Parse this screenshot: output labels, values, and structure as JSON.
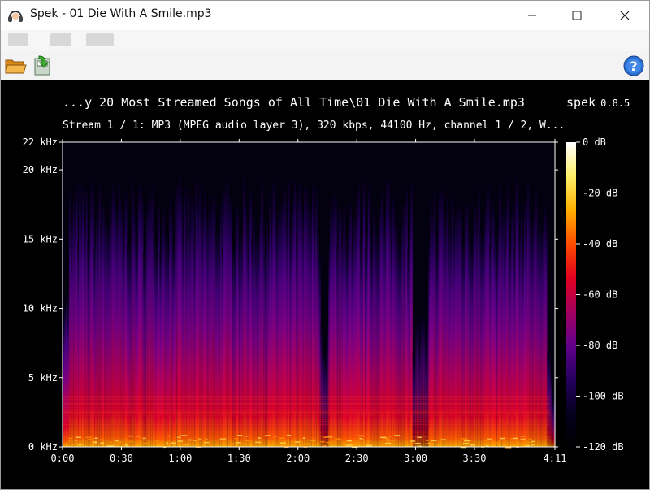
{
  "window": {
    "title": "Spek - 01 Die With A Smile.mp3",
    "app_icon": "headphones-icon",
    "controls": [
      "minimize-icon",
      "maximize-icon",
      "close-icon"
    ]
  },
  "menubar": {
    "note": ""
  },
  "toolbar": {
    "open_icon": "folder-open-icon",
    "save_icon": "save-export-icon",
    "help_icon": "help-icon"
  },
  "spectrogram": {
    "file_title": "...y 20 Most Streamed Songs of All Time\\01 Die With A Smile.mp3",
    "brand": "spek",
    "version": "0.8.5",
    "stream_info": "Stream 1 / 1: MP3 (MPEG audio layer 3), 320 kbps, 44100 Hz, channel 1 / 2, W..."
  },
  "chart_data": {
    "type": "heatmap",
    "xlabel": "",
    "ylabel": "",
    "x_ticks": [
      "0:00",
      "0:30",
      "1:00",
      "1:30",
      "2:00",
      "2:30",
      "3:00",
      "3:30",
      "4:11"
    ],
    "x_tick_seconds": [
      0,
      30,
      60,
      90,
      120,
      150,
      180,
      210,
      251
    ],
    "y_ticks": [
      "0 kHz",
      "5 kHz",
      "10 kHz",
      "15 kHz",
      "20 kHz",
      "22 kHz"
    ],
    "y_tick_khz": [
      0,
      5,
      10,
      15,
      20,
      22
    ],
    "xlim": [
      0,
      251
    ],
    "ylim": [
      0,
      22
    ],
    "colorbar_labels": [
      "0 dB",
      "-20 dB",
      "-40 dB",
      "-60 dB",
      "-80 dB",
      "-100 dB",
      "-120 dB"
    ],
    "colorbar_db": [
      0,
      -20,
      -40,
      -60,
      -80,
      -100,
      -120
    ],
    "colormap": [
      "#ffffff",
      "#fff06a",
      "#ffb000",
      "#ff4d00",
      "#e2001e",
      "#a4005e",
      "#62008c",
      "#250060",
      "#05001e",
      "#000000"
    ],
    "energy_profile": {
      "quiet_sections_seconds": [
        [
          178,
          186
        ],
        [
          131,
          135
        ]
      ],
      "cutoff_khz": 19.5
    }
  }
}
